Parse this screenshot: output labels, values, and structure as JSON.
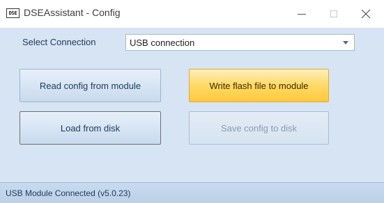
{
  "window": {
    "title": "DSEAssistant - Config",
    "app_icon_text": "DSE"
  },
  "connection": {
    "label": "Select Connection",
    "selected": "USB connection"
  },
  "buttons": {
    "read": "Read config from module",
    "write": "Write flash file to module",
    "load": "Load from disk",
    "save": "Save config to disk"
  },
  "status": {
    "text": "USB Module Connected (v5.0.23)"
  },
  "colors": {
    "client_background": "#d6e4f3",
    "accent_button": "#ffd966",
    "status_bar": "#c9daee"
  },
  "icons": [
    "app-icon",
    "minimize-icon",
    "maximize-icon",
    "close-icon",
    "chevron-down-icon"
  ]
}
